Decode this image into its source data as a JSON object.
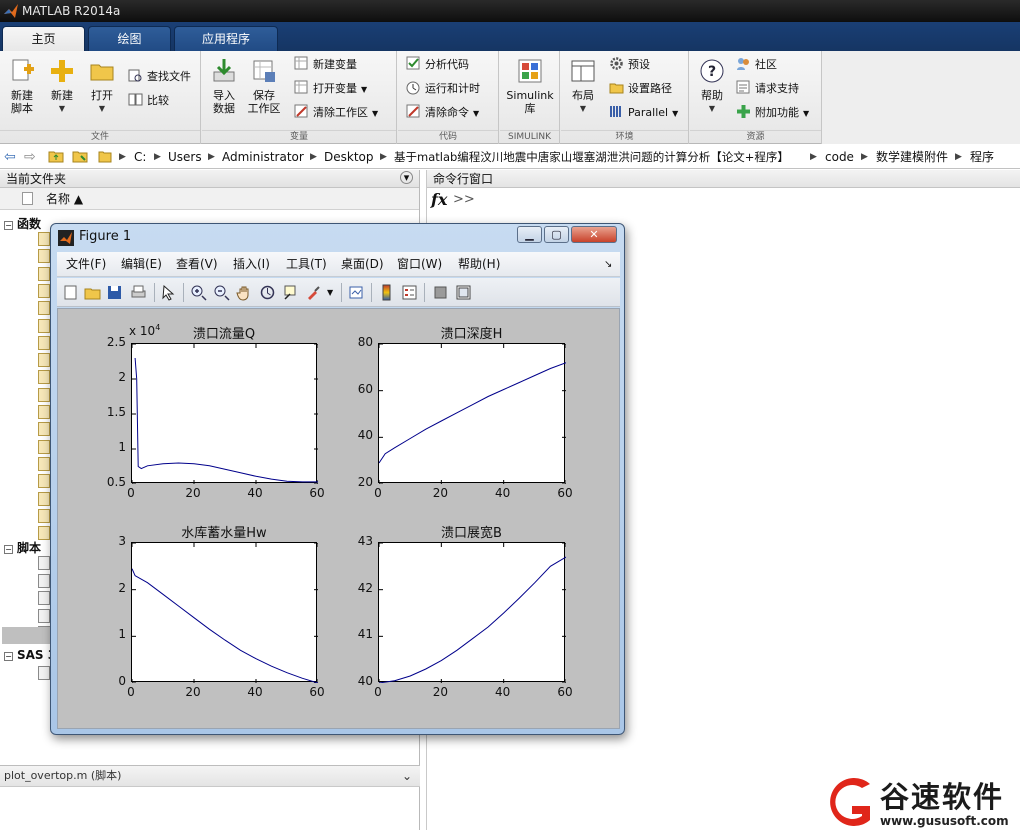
{
  "window": {
    "title": "MATLAB R2014a"
  },
  "ribbon_tabs": [
    {
      "label": "主页",
      "active": true
    },
    {
      "label": "绘图",
      "active": false
    },
    {
      "label": "应用程序",
      "active": false
    }
  ],
  "ribbon": {
    "file": {
      "label": "文件",
      "new_script": "新建\n脚本",
      "new": "新建",
      "open": "打开",
      "find_files": "查找文件",
      "compare": "比较"
    },
    "variable": {
      "label": "变量",
      "import": "导入\n数据",
      "save_ws": "保存\n工作区",
      "new_var": "新建变量",
      "open_var": "打开变量",
      "clear_ws": "清除工作区"
    },
    "code": {
      "label": "代码",
      "analyze": "分析代码",
      "run_time": "运行和计时",
      "clear_cmd": "清除命令"
    },
    "simulink": {
      "label": "SIMULINK",
      "lib": "Simulink\n库"
    },
    "env": {
      "label": "环境",
      "layout": "布局",
      "prefs": "预设",
      "set_path": "设置路径",
      "parallel": "Parallel"
    },
    "resources": {
      "label": "资源",
      "help": "帮助",
      "community": "社区",
      "request_support": "请求支持",
      "addons": "附加功能"
    }
  },
  "address": {
    "segments": [
      "C:",
      "Users",
      "Administrator",
      "Desktop",
      "基于matlab编程汶川地震中唐家山堰塞湖泄洪问题的计算分析【论文+程序】",
      "code",
      "数学建模附件",
      "程序"
    ]
  },
  "current_folder": {
    "title": "当前文件夹",
    "col_name": "名称 ▲",
    "sections": [
      {
        "label": "函数"
      },
      {
        "label": "脚本"
      },
      {
        "label": "SAS 3"
      }
    ]
  },
  "command_window": {
    "title": "命令行窗口",
    "fx": "fx",
    "prompt": ">>"
  },
  "details": {
    "text": "plot_overtop.m (脚本)"
  },
  "figure": {
    "title": "Figure 1",
    "menu": [
      "文件(F)",
      "编辑(E)",
      "查看(V)",
      "插入(I)",
      "工具(T)",
      "桌面(D)",
      "窗口(W)",
      "帮助(H)"
    ]
  },
  "chart_data": [
    {
      "type": "line",
      "title": "溃口流量Q",
      "scale_label": "x 10",
      "scale_exp": "4",
      "xlim": [
        0,
        60
      ],
      "ylim": [
        0.5,
        2.5
      ],
      "xticks": [
        "0",
        "20",
        "40",
        "60"
      ],
      "yticks": [
        "0.5",
        "1",
        "1.5",
        "2",
        "2.5"
      ],
      "x": [
        1,
        1.5,
        2,
        3,
        5,
        10,
        15,
        20,
        25,
        30,
        35,
        40,
        45,
        50,
        55,
        60
      ],
      "y": [
        2.3,
        2.0,
        0.75,
        0.72,
        0.76,
        0.79,
        0.8,
        0.79,
        0.76,
        0.71,
        0.66,
        0.61,
        0.57,
        0.54,
        0.53,
        0.53
      ],
      "color": "#00008b"
    },
    {
      "type": "line",
      "title": "溃口深度H",
      "xlim": [
        0,
        60
      ],
      "ylim": [
        20,
        80
      ],
      "xticks": [
        "0",
        "20",
        "40",
        "60"
      ],
      "yticks": [
        "20",
        "40",
        "60",
        "80"
      ],
      "x": [
        0,
        2,
        5,
        10,
        15,
        20,
        25,
        30,
        35,
        40,
        45,
        50,
        55,
        60
      ],
      "y": [
        29,
        33,
        35.5,
        39.5,
        43.5,
        47,
        50.5,
        54,
        57.5,
        60.5,
        63.5,
        66.5,
        69.5,
        72
      ],
      "color": "#00008b"
    },
    {
      "type": "line",
      "title": "水库蓄水量Hw",
      "xlim": [
        0,
        60
      ],
      "ylim": [
        0,
        3
      ],
      "xticks": [
        "0",
        "20",
        "40",
        "60"
      ],
      "yticks": [
        "0",
        "1",
        "2",
        "3"
      ],
      "x": [
        0,
        1,
        5,
        10,
        15,
        20,
        25,
        30,
        35,
        40,
        45,
        50,
        55,
        60
      ],
      "y": [
        2.45,
        2.3,
        2.15,
        1.9,
        1.65,
        1.4,
        1.15,
        0.92,
        0.7,
        0.52,
        0.36,
        0.22,
        0.1,
        0.0
      ],
      "color": "#00008b"
    },
    {
      "type": "line",
      "title": "溃口展宽B",
      "xlim": [
        0,
        60
      ],
      "ylim": [
        40,
        43
      ],
      "xticks": [
        "0",
        "20",
        "40",
        "60"
      ],
      "yticks": [
        "40",
        "41",
        "42",
        "43"
      ],
      "x": [
        0,
        5,
        10,
        15,
        20,
        25,
        30,
        35,
        40,
        45,
        50,
        55,
        60
      ],
      "y": [
        40.0,
        40.05,
        40.15,
        40.3,
        40.48,
        40.7,
        40.95,
        41.2,
        41.5,
        41.82,
        42.15,
        42.5,
        42.7
      ],
      "color": "#00008b"
    }
  ],
  "watermark": {
    "brand": "谷速软件",
    "url": "www.gususoft.com",
    "brand_color": "#e0261a"
  }
}
